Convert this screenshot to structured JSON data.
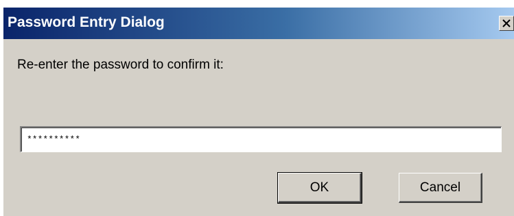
{
  "window": {
    "title": "Password Entry Dialog"
  },
  "icons": {
    "close": "close-icon"
  },
  "dialog": {
    "prompt": "Re-enter the password to confirm it:",
    "password_value": "**********"
  },
  "buttons": {
    "ok_label": "OK",
    "cancel_label": "Cancel"
  },
  "colors": {
    "titlebar_start": "#0a246a",
    "titlebar_end": "#a6caf0",
    "window_bg": "#d4d0c8"
  }
}
